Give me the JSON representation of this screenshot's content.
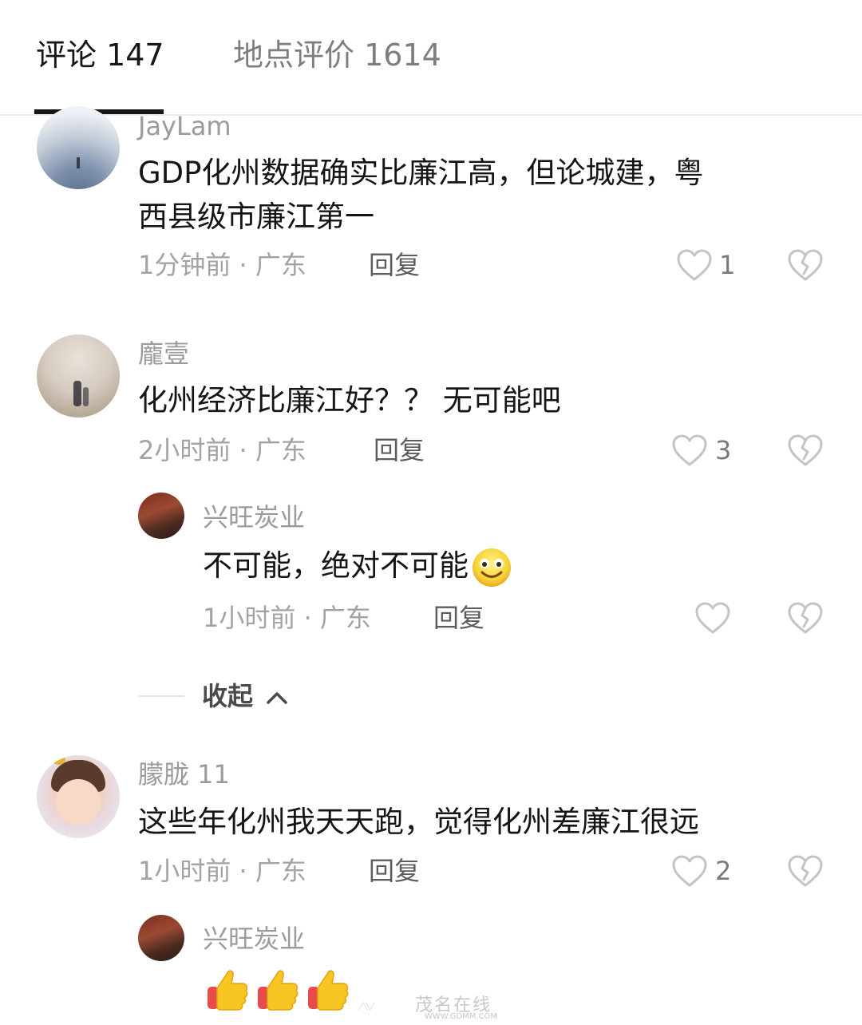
{
  "tabs": [
    {
      "label": "评论 147",
      "active": true
    },
    {
      "label": "地点评价 1614",
      "active": false
    }
  ],
  "comments": [
    {
      "username": "JayLam",
      "text_lines": [
        "GDP化州数据确实比廉江高，但论城建，粤",
        "西县级市廉江第一"
      ],
      "meta": "1分钟前 · 广东",
      "reply": "回复",
      "likes": "1"
    },
    {
      "username": "龐壹",
      "text_lines": [
        "化州经济比廉江好？？ 无可能吧"
      ],
      "meta": "2小时前 · 广东",
      "reply": "回复",
      "likes": "3",
      "replies": [
        {
          "username": "兴旺炭业",
          "text": "不可能，绝对不可能",
          "meta": "1小时前 · 广东",
          "reply": "回复",
          "likes": ""
        }
      ]
    },
    {
      "username": "朦胧 11",
      "text_lines": [
        "这些年化州我天天跑，觉得化州差廉江很远"
      ],
      "meta": "1小时前 · 广东",
      "reply": "回复",
      "likes": "2",
      "replies": [
        {
          "username": "兴旺炭业"
        }
      ]
    }
  ],
  "collapse": {
    "label": "收起"
  },
  "watermark": {
    "text": "茂名在线",
    "url": "WWW.GDMM.COM"
  },
  "colors": {
    "like_outline": "#c4c4c4",
    "thumb_emoji": "#f7c623",
    "thumb_sleeve": "#e94b4b"
  }
}
